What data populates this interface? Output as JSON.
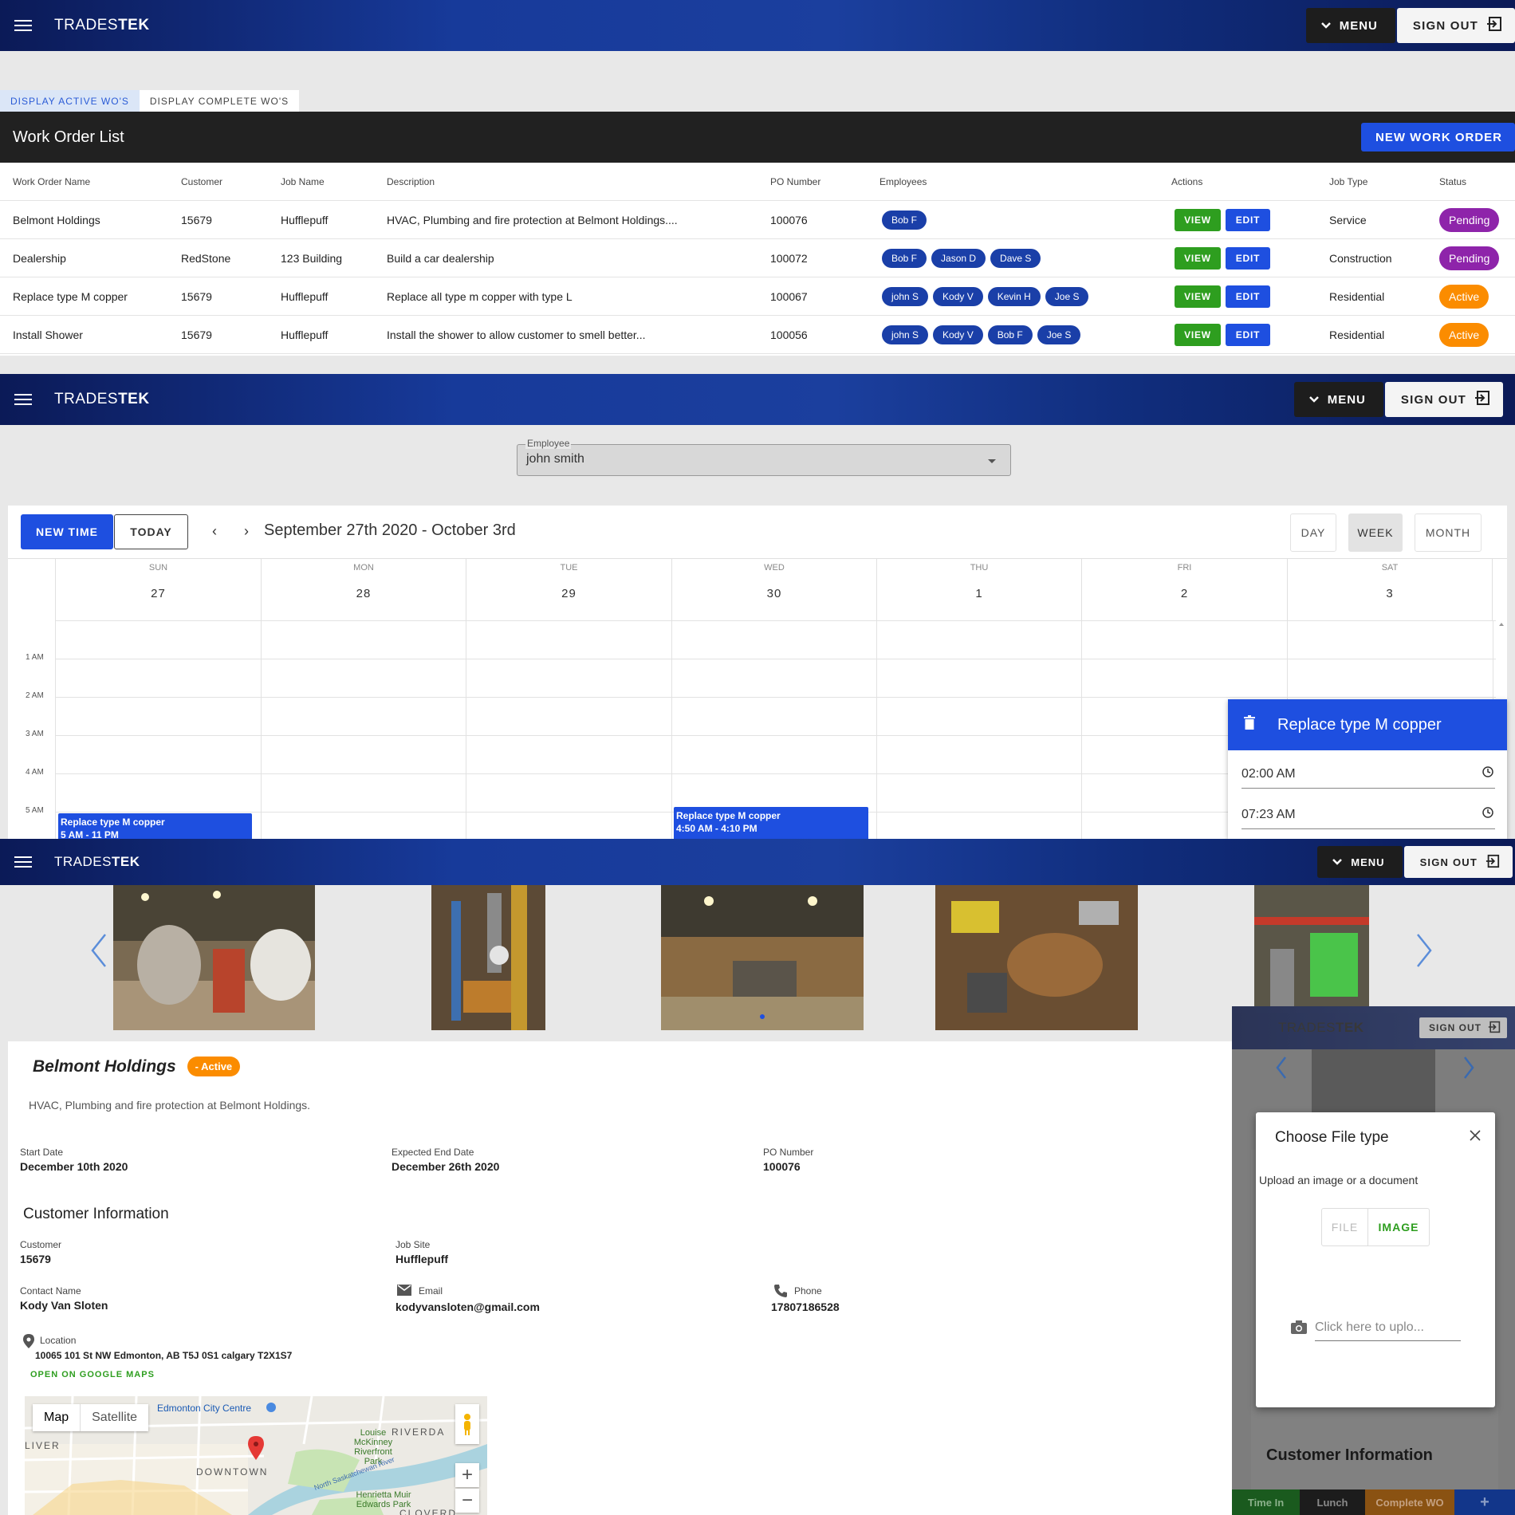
{
  "app": {
    "logo_light": "TRADES",
    "logo_bold": "TEK",
    "menu_label": "MENU",
    "signout_label": "SIGN OUT"
  },
  "work_orders": {
    "tabs": [
      "DISPLAY ACTIVE WO'S",
      "DISPLAY COMPLETE WO'S"
    ],
    "title": "Work Order List",
    "new_button": "NEW WORK ORDER",
    "columns": [
      "Work Order Name",
      "Customer",
      "Job Name",
      "Description",
      "PO Number",
      "Employees",
      "Actions",
      "Job Type",
      "Status"
    ],
    "view_label": "VIEW",
    "edit_label": "EDIT",
    "rows": [
      {
        "name": "Belmont Holdings",
        "customer": "15679",
        "job": "Hufflepuff",
        "description": "HVAC, Plumbing and fire protection at Belmont Holdings....",
        "po": "100076",
        "employees": [
          "Bob F"
        ],
        "job_type": "Service",
        "status": "Pending"
      },
      {
        "name": "Dealership",
        "customer": "RedStone",
        "job": "123 Building",
        "description": "Build a car dealership",
        "po": "100072",
        "employees": [
          "Bob F",
          "Jason D",
          "Dave S"
        ],
        "job_type": "Construction",
        "status": "Pending"
      },
      {
        "name": "Replace type M copper",
        "customer": "15679",
        "job": "Hufflepuff",
        "description": "Replace all type m copper with type L",
        "po": "100067",
        "employees": [
          "john S",
          "Kody V",
          "Kevin H",
          "Joe S"
        ],
        "job_type": "Residential",
        "status": "Active"
      },
      {
        "name": "Install Shower",
        "customer": "15679",
        "job": "Hufflepuff",
        "description": "Install the shower to allow customer to smell better...",
        "po": "100056",
        "employees": [
          "john S",
          "Kody V",
          "Bob F",
          "Joe S"
        ],
        "job_type": "Residential",
        "status": "Active"
      }
    ]
  },
  "calendar": {
    "employee_label": "Employee",
    "employee_value": "john smith",
    "new_time": "NEW TIME",
    "today": "TODAY",
    "range": "September 27th 2020 - October 3rd",
    "views": [
      "DAY",
      "WEEK",
      "MONTH"
    ],
    "days": [
      {
        "dow": "SUN",
        "num": "27"
      },
      {
        "dow": "MON",
        "num": "28"
      },
      {
        "dow": "TUE",
        "num": "29"
      },
      {
        "dow": "WED",
        "num": "30"
      },
      {
        "dow": "THU",
        "num": "1"
      },
      {
        "dow": "FRI",
        "num": "2"
      },
      {
        "dow": "SAT",
        "num": "3"
      }
    ],
    "hours": [
      "1 AM",
      "2 AM",
      "3 AM",
      "4 AM",
      "5 AM"
    ],
    "events": [
      {
        "title": "Replace type M copper",
        "time": "5 AM - 11 PM"
      },
      {
        "title": "Replace type M copper",
        "time": "4:50 AM - 4:10 PM"
      }
    ],
    "popup": {
      "title": "Replace type M copper",
      "start": "02:00 AM",
      "end": "07:23 AM"
    }
  },
  "job_detail": {
    "name": "Belmont Holdings",
    "status": "- Active",
    "description": "HVAC, Plumbing and fire protection at Belmont Holdings.",
    "start_label": "Start Date",
    "start_value": "December 10th 2020",
    "end_label": "Expected End Date",
    "end_value": "December 26th 2020",
    "po_label": "PO Number",
    "po_value": "100076",
    "customer_section": "Customer Information",
    "customer_label": "Customer",
    "customer_value": "15679",
    "jobsite_label": "Job Site",
    "jobsite_value": "Hufflepuff",
    "contact_label": "Contact Name",
    "contact_value": "Kody Van Sloten",
    "email_label": "Email",
    "email_value": "kodyvansloten@gmail.com",
    "phone_label": "Phone",
    "phone_value": "17807186528",
    "location_label": "Location",
    "location_value": "10065 101 St NW Edmonton, AB T5J 0S1 calgary T2X1S7",
    "maps_link": "OPEN ON GOOGLE MAPS",
    "map": {
      "tab_map": "Map",
      "tab_satellite": "Satellite",
      "labels": [
        "Edmonton City Centre",
        "DOWNTOWN",
        "Louise McKinney Riverfront Park",
        "North Saskatchewan River",
        "Henrietta Muir Edwards Park",
        "RIVERDA",
        "LIVER",
        "CLOVERD"
      ]
    }
  },
  "upload_panel": {
    "logo_light": "TRADES",
    "logo_bold": "TEK",
    "signout_label": "SIGN OUT",
    "dialog_title": "Choose File type",
    "dialog_sub": "Upload an image or a document",
    "file_btn": "FILE",
    "image_btn": "IMAGE",
    "upload_placeholder": "Click here to uplo...",
    "customer_section": "Customer Information",
    "bottom": [
      "Time In",
      "Lunch",
      "Complete WO",
      "+"
    ]
  }
}
